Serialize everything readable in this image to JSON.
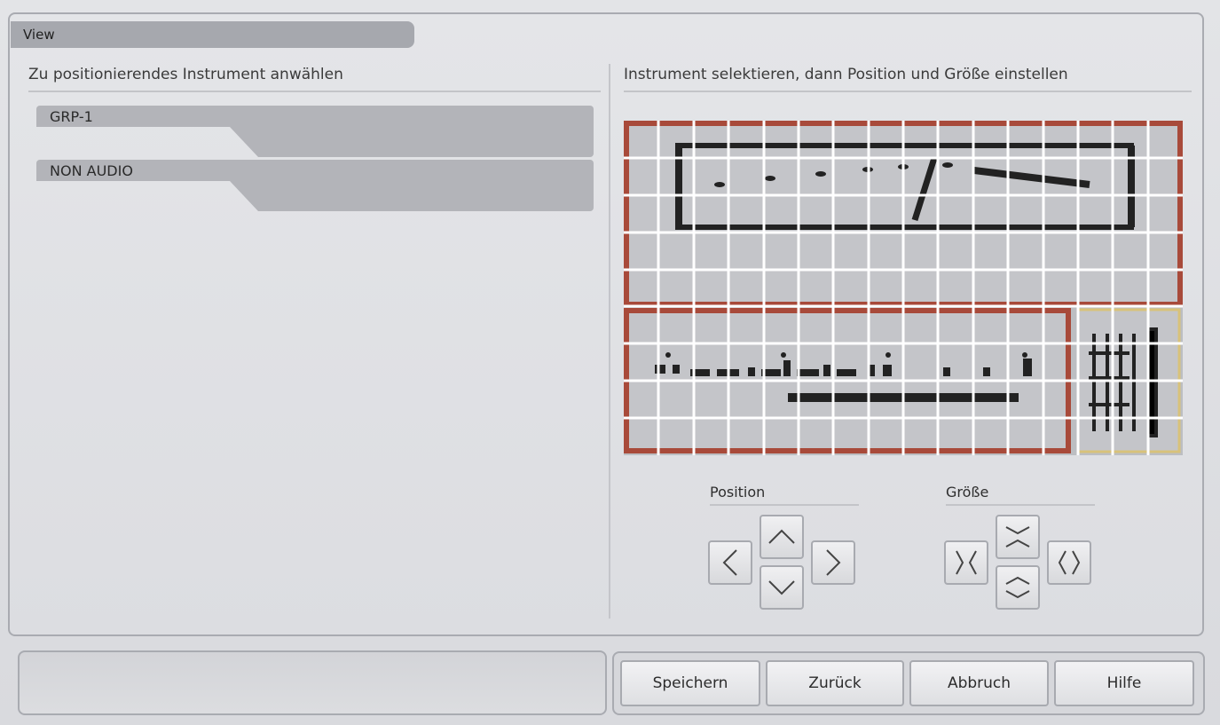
{
  "window": {
    "tab_label": "View"
  },
  "left_panel": {
    "title": "Zu positionierendes Instrument anwählen",
    "instruments": [
      {
        "label": "GRP-1"
      },
      {
        "label": "NON AUDIO"
      }
    ]
  },
  "right_panel": {
    "title": "Instrument selektieren, dann Position und Größe einstellen",
    "position_label": "Position",
    "size_label": "Größe"
  },
  "footer": {
    "buttons": {
      "save": "Speichern",
      "back": "Zurück",
      "cancel": "Abbruch",
      "help": "Hilfe"
    }
  },
  "colors": {
    "instrument_frame": "#a84a3a",
    "selected_frame": "#d8c27a",
    "grid": "#ffffff",
    "panel_bg": "#dcdde1"
  }
}
